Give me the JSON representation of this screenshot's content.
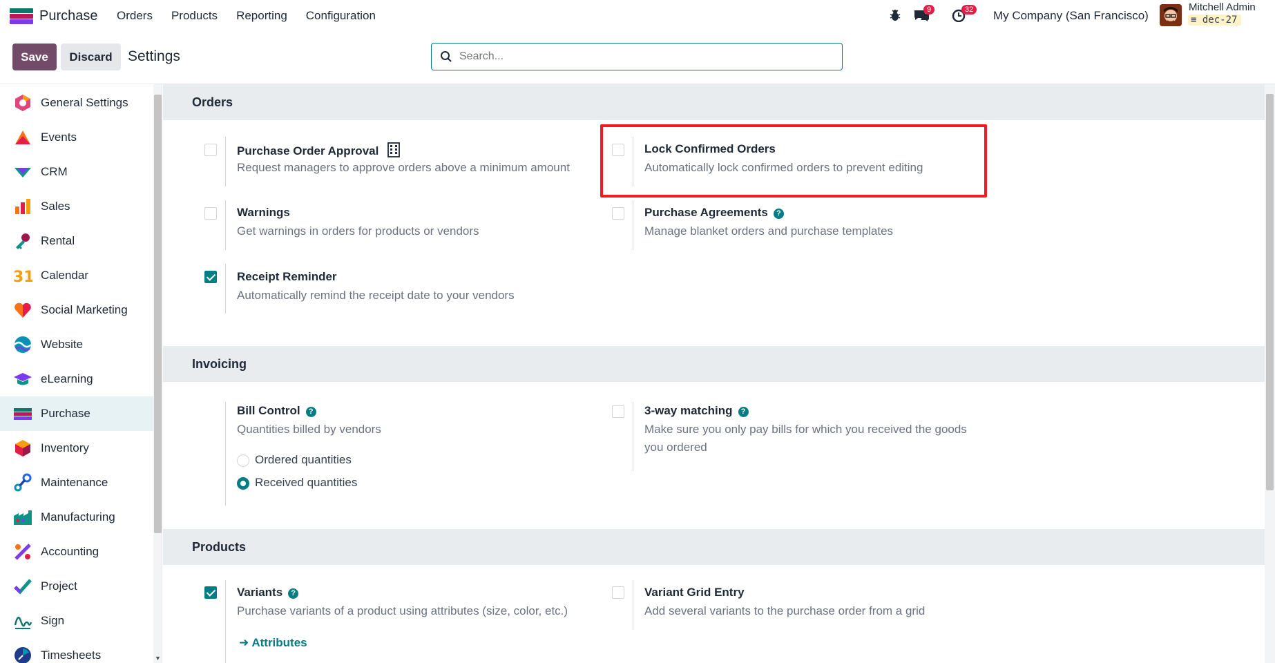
{
  "navbar": {
    "app_name": "Purchase",
    "menu": [
      "Orders",
      "Products",
      "Reporting",
      "Configuration"
    ],
    "messages_badge": "9",
    "activities_badge": "32",
    "company": "My Company (San Francisco)",
    "user_name": "Mitchell Admin",
    "database": "dec-27"
  },
  "control": {
    "save_label": "Save",
    "discard_label": "Discard",
    "title": "Settings",
    "search_placeholder": "Search..."
  },
  "sidebar": {
    "items": [
      {
        "label": "General Settings",
        "icon": "general-settings-icon"
      },
      {
        "label": "Events",
        "icon": "events-icon"
      },
      {
        "label": "CRM",
        "icon": "crm-icon"
      },
      {
        "label": "Sales",
        "icon": "sales-icon"
      },
      {
        "label": "Rental",
        "icon": "rental-icon"
      },
      {
        "label": "Calendar",
        "icon": "calendar-icon"
      },
      {
        "label": "Social Marketing",
        "icon": "social-marketing-icon"
      },
      {
        "label": "Website",
        "icon": "website-icon"
      },
      {
        "label": "eLearning",
        "icon": "elearning-icon"
      },
      {
        "label": "Purchase",
        "icon": "purchase-icon",
        "active": true
      },
      {
        "label": "Inventory",
        "icon": "inventory-icon"
      },
      {
        "label": "Maintenance",
        "icon": "maintenance-icon"
      },
      {
        "label": "Manufacturing",
        "icon": "manufacturing-icon"
      },
      {
        "label": "Accounting",
        "icon": "accounting-icon"
      },
      {
        "label": "Project",
        "icon": "project-icon"
      },
      {
        "label": "Sign",
        "icon": "sign-icon"
      },
      {
        "label": "Timesheets",
        "icon": "timesheets-icon"
      }
    ],
    "calendar_day": "31"
  },
  "sections": {
    "orders": {
      "title": "Orders",
      "po_approval": {
        "title": "Purchase Order Approval",
        "desc": "Request managers to approve orders above a minimum amount",
        "checked": false
      },
      "lock_orders": {
        "title": "Lock Confirmed Orders",
        "desc": "Automatically lock confirmed orders to prevent editing",
        "checked": false
      },
      "warnings": {
        "title": "Warnings",
        "desc": "Get warnings in orders for products or vendors",
        "checked": false
      },
      "agreements": {
        "title": "Purchase Agreements",
        "desc": "Manage blanket orders and purchase templates",
        "checked": false
      },
      "receipt_reminder": {
        "title": "Receipt Reminder",
        "desc": "Automatically remind the receipt date to your vendors",
        "checked": true
      }
    },
    "invoicing": {
      "title": "Invoicing",
      "bill_control": {
        "title": "Bill Control",
        "desc": "Quantities billed by vendors",
        "option_ordered": "Ordered quantities",
        "option_received": "Received quantities",
        "selected": "Received quantities"
      },
      "three_way": {
        "title": "3-way matching",
        "desc_line1": "Make sure you only pay bills for which you received the goods",
        "desc_line2": "you ordered",
        "checked": false
      }
    },
    "products": {
      "title": "Products",
      "variants": {
        "title": "Variants",
        "desc": "Purchase variants of a product using attributes (size, color, etc.)",
        "checked": true,
        "link": "Attributes"
      },
      "variant_grid": {
        "title": "Variant Grid Entry",
        "desc": "Add several variants to the purchase order from a grid",
        "checked": false
      }
    }
  },
  "colors": {
    "brand": "#714b67",
    "accent": "#017e84",
    "highlight": "#ef1c24"
  }
}
